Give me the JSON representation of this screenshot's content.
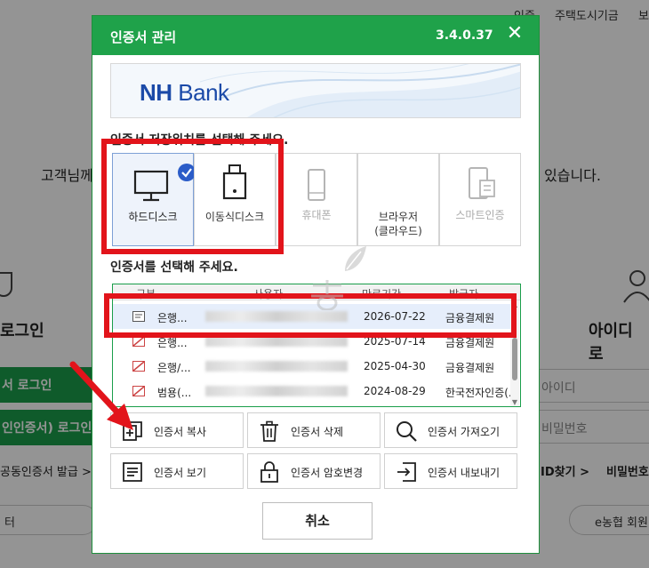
{
  "background": {
    "top_nav": [
      "인증",
      "주택도시기금",
      "보"
    ],
    "greeting_left": "고객님께",
    "greeting_right": "있습니다.",
    "login_left": "로그인",
    "login_right": "아이디 로",
    "btn_login": "서 로그인",
    "btn_cert_login": "인인증서) 로그인",
    "input_id": "아이디",
    "input_pw": "비밀번호",
    "link_issue": "공동인증서 발급 >",
    "link_id_find": "ID찾기 >",
    "link_pw_find": "비밀번호",
    "pill_left": "터",
    "pill_right": "e농협 회원"
  },
  "dialog": {
    "title": "인증서 관리",
    "version": "3.4.0.37",
    "close_glyph": "✕",
    "banner": {
      "logo_nh": "NH",
      "logo_bank": "Bank"
    },
    "location_label": "인증서 저장위치를 선택해 주세요.",
    "storage": [
      {
        "label": "하드디스크",
        "selected": true,
        "enabled": true
      },
      {
        "label": "이동식디스크",
        "selected": false,
        "enabled": true
      },
      {
        "label": "휴대폰",
        "selected": false,
        "enabled": false
      },
      {
        "label": "브라우저\n(클라우드)",
        "line1": "브라우저",
        "line2": "(클라우드)",
        "selected": false,
        "enabled": true
      },
      {
        "label": "스마트인증",
        "selected": false,
        "enabled": false
      }
    ],
    "cert_label": "인증서를 선택해 주세요.",
    "table": {
      "headers": [
        "구분",
        "사용자",
        "만료기간",
        "발급자"
      ],
      "rows": [
        {
          "type": "은행...",
          "date": "2026-07-22",
          "issuer": "금융결제원",
          "status": "valid"
        },
        {
          "type": "은행...",
          "date": "2025-07-14",
          "issuer": "금융결제원",
          "status": "expired"
        },
        {
          "type": "은행/...",
          "date": "2025-04-30",
          "issuer": "금융결제원",
          "status": "expired"
        },
        {
          "type": "범용(...",
          "date": "2024-08-29",
          "issuer": "한국전자인증(...",
          "status": "expired"
        }
      ]
    },
    "actions": {
      "copy": "인증서 복사",
      "delete": "인증서 삭제",
      "import": "인증서 가져오기",
      "view": "인증서 보기",
      "password": "인증서 암호변경",
      "export": "인증서 내보내기"
    },
    "cancel": "취소"
  },
  "colors": {
    "title_bar": "#1fa24a",
    "annotation": "#e2141b",
    "brand_blue": "#1b4aa8"
  },
  "icons": [
    "check-badge-icon",
    "monitor-icon",
    "usb-drive-icon",
    "phone-icon",
    "cloud-browser-icon",
    "smart-cert-icon",
    "cert-card-icon",
    "copy-icon",
    "trash-icon",
    "search-icon",
    "document-icon",
    "lock-icon",
    "export-icon"
  ]
}
